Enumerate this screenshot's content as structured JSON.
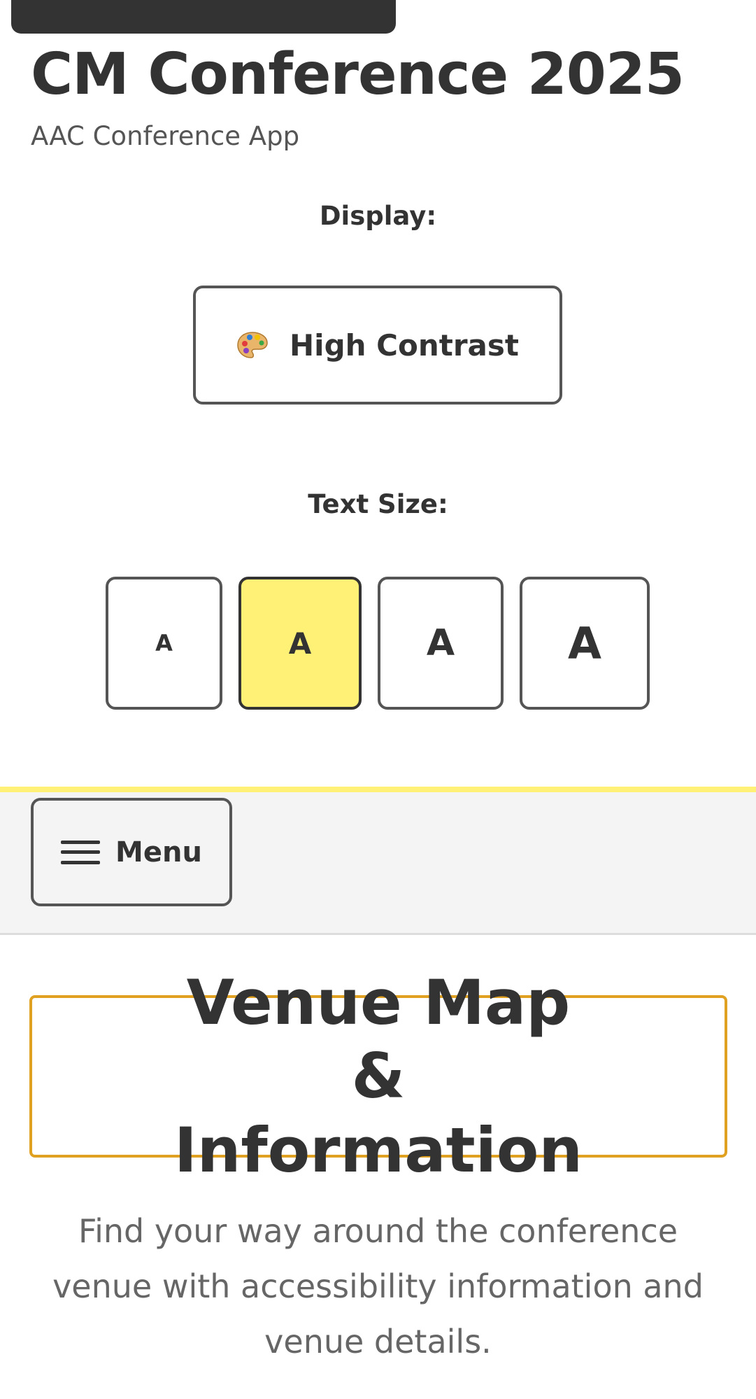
{
  "header": {
    "title": "CM Conference 2025",
    "subtitle": "AAC Conference App"
  },
  "display": {
    "label": "Display:",
    "contrast_button": {
      "icon": "palette-icon",
      "label": "High Contrast"
    }
  },
  "text_size": {
    "label": "Text Size:",
    "options": [
      {
        "label": "A",
        "selected": false
      },
      {
        "label": "A",
        "selected": true
      },
      {
        "label": "A",
        "selected": false
      },
      {
        "label": "A",
        "selected": false
      }
    ]
  },
  "nav": {
    "menu_icon": "hamburger-icon",
    "menu_label": "Menu"
  },
  "page": {
    "heading": "Venue Map & Information",
    "description": "Find your way around the conference venue with accessibility information and venue details."
  },
  "colors": {
    "accent_yellow": "#fff176",
    "heading_border": "#e0a020",
    "text_dark": "#333333"
  }
}
